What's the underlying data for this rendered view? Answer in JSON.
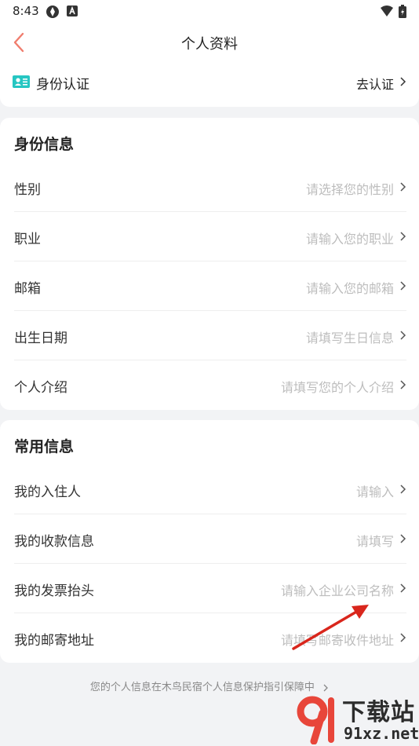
{
  "status_bar": {
    "time": "8:43",
    "icons": [
      "sync-icon",
      "a-badge-icon",
      "wifi-icon",
      "battery-icon"
    ]
  },
  "nav": {
    "title": "个人资料",
    "back_icon": "chevron-left-icon",
    "accent_color": "#f07d6e"
  },
  "verification": {
    "label": "身份认证",
    "action": "去认证",
    "icon": "id-card-icon",
    "icon_color": "#26c6c2"
  },
  "identity_section": {
    "title": "身份信息",
    "rows": [
      {
        "label": "性别",
        "placeholder": "请选择您的性别"
      },
      {
        "label": "职业",
        "placeholder": "请输入您的职业"
      },
      {
        "label": "邮箱",
        "placeholder": "请输入您的邮箱"
      },
      {
        "label": "出生日期",
        "placeholder": "请填写生日信息"
      },
      {
        "label": "个人介绍",
        "placeholder": "请填写您的个人介绍"
      }
    ]
  },
  "common_section": {
    "title": "常用信息",
    "rows": [
      {
        "label": "我的入住人",
        "placeholder": "请输入"
      },
      {
        "label": "我的收款信息",
        "placeholder": "请填写"
      },
      {
        "label": "我的发票抬头",
        "placeholder": "请输入企业公司名称"
      },
      {
        "label": "我的邮寄地址",
        "placeholder": "请填写邮寄收件地址"
      }
    ]
  },
  "footer": {
    "text": "您的个人信息在木鸟民宿个人信息保护指引保障中"
  },
  "annotation": {
    "arrow_color": "#d9261c"
  },
  "watermark": {
    "main": "下载站",
    "sub": "91xz.net",
    "logo_color": "#e8463a"
  }
}
